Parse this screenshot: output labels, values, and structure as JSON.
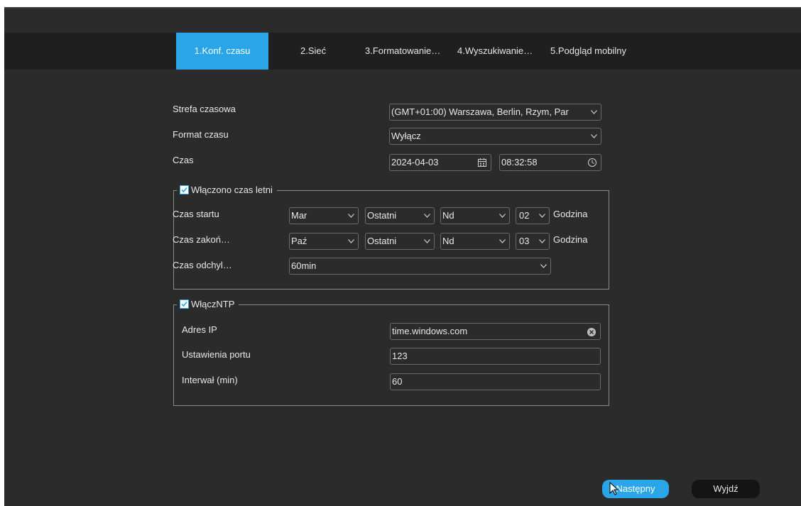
{
  "tabs": [
    {
      "label": "1.Konf. czasu",
      "active": true
    },
    {
      "label": "2.Sieć",
      "active": false
    },
    {
      "label": "3.Formatowanie…",
      "active": false
    },
    {
      "label": "4.Wyszukiwanie…",
      "active": false
    },
    {
      "label": "5.Podgląd mobilny",
      "active": false
    }
  ],
  "general": {
    "timezone_label": "Strefa czasowa",
    "timezone_value": "(GMT+01:00) Warszawa, Berlin, Rzym, Par",
    "timeformat_label": "Format czasu",
    "timeformat_value": "Wyłącz",
    "time_label": "Czas",
    "date_value": "2024-04-03",
    "clock_value": "08:32:58"
  },
  "dst": {
    "legend": "Włączono czas letni",
    "checked": true,
    "start_label": "Czas startu",
    "end_label": "Czas zakoń…",
    "offset_label": "Czas odchyl…",
    "start": {
      "month": "Mar",
      "week": "Ostatni",
      "day": "Nd",
      "hour": "02",
      "unit": "Godzina"
    },
    "end": {
      "month": "Paź",
      "week": "Ostatni",
      "day": "Nd",
      "hour": "03",
      "unit": "Godzina"
    },
    "offset_value": "60min"
  },
  "ntp": {
    "legend": "WłączNTP",
    "checked": true,
    "ip_label": "Adres IP",
    "ip_value": "time.windows.com",
    "port_label": "Ustawienia portu",
    "port_value": "123",
    "interval_label": "Interwał (min)",
    "interval_value": "60"
  },
  "buttons": {
    "next": "Następny",
    "exit": "Wyjdź"
  },
  "colors": {
    "accent": "#2aa6e8",
    "background": "#2b2b2b",
    "tabbar": "#1f1f1f"
  }
}
